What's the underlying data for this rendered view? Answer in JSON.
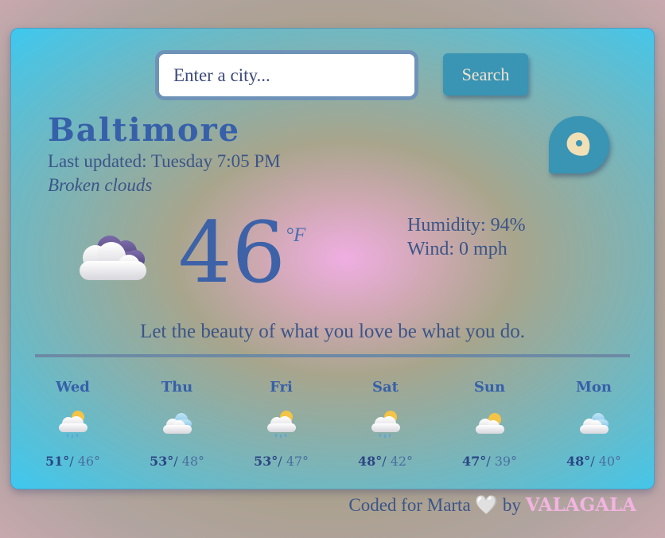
{
  "search": {
    "placeholder": "Enter a city...",
    "value": "",
    "button_label": "Search"
  },
  "current": {
    "city": "Baltimore",
    "updated": "Last updated: Tuesday 7:05 PM",
    "description": "Broken clouds",
    "temperature": "46",
    "unit": "°F",
    "humidity": "Humidity: 94%",
    "wind": "Wind: 0 mph",
    "icon": "broken-clouds-icon"
  },
  "quote": "Let the beauty of what you love be what you do.",
  "forecast": [
    {
      "day": "Wed",
      "high": "51°",
      "low": "46°",
      "icon": "sun-cloud-rain-icon"
    },
    {
      "day": "Thu",
      "high": "53°",
      "low": "48°",
      "icon": "clouds-icon"
    },
    {
      "day": "Fri",
      "high": "53°",
      "low": "47°",
      "icon": "sun-cloud-rain-icon"
    },
    {
      "day": "Sat",
      "high": "48°",
      "low": "42°",
      "icon": "sun-cloud-rain-icon"
    },
    {
      "day": "Sun",
      "high": "47°",
      "low": "39°",
      "icon": "sun-cloud-icon"
    },
    {
      "day": "Mon",
      "high": "48°",
      "low": "40°",
      "icon": "clouds-icon"
    }
  ],
  "footer": {
    "prefix": "Coded for Marta",
    "heart": "🤍",
    "by": " by ",
    "author": "VALAGALA"
  },
  "colors": {
    "accent": "#3a94b3",
    "title": "#3660a9",
    "brand": "#f2b4e0"
  }
}
